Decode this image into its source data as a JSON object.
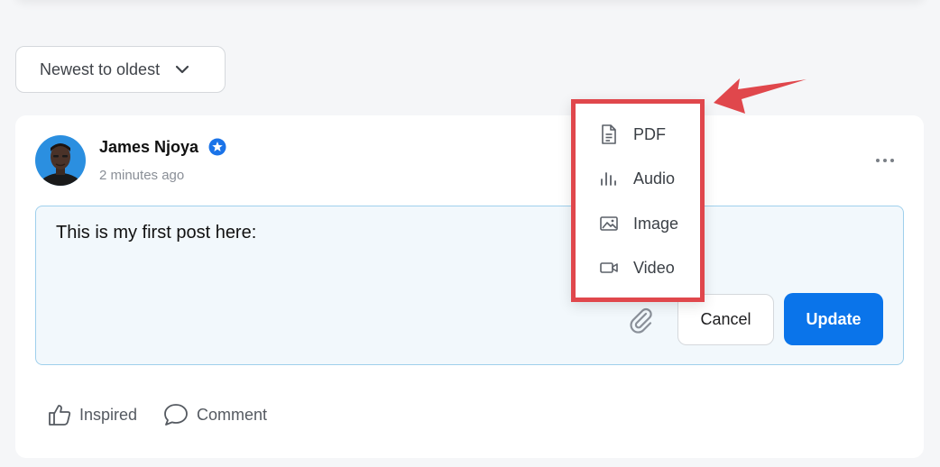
{
  "sort": {
    "selected": "Newest to oldest",
    "icon": "chevron-down-icon"
  },
  "post": {
    "author": "James Njoya",
    "time": "2 minutes ago",
    "verified_icon": "verified-badge-icon",
    "body": "This is my first post here:",
    "more_icon": "more-horizontal-icon"
  },
  "editor": {
    "attach_icon": "paperclip-icon",
    "cancel_label": "Cancel",
    "update_label": "Update"
  },
  "attach_menu": {
    "items": [
      {
        "label": "PDF",
        "icon": "document-icon"
      },
      {
        "label": "Audio",
        "icon": "audio-bars-icon"
      },
      {
        "label": "Image",
        "icon": "image-icon"
      },
      {
        "label": "Video",
        "icon": "video-camera-icon"
      }
    ]
  },
  "actions": {
    "inspired_label": "Inspired",
    "comment_label": "Comment"
  },
  "colors": {
    "accent": "#0a74ea",
    "highlight": "#e0474c",
    "editor_border": "#9fd0ec",
    "verified": "#1a73e8"
  }
}
